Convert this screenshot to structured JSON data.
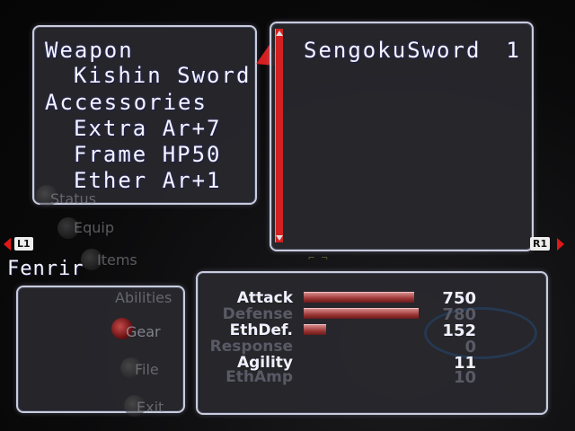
{
  "equipment": {
    "weapon_label": "Weapon",
    "weapon_value": "Kishin Sword",
    "accessories_label": "Accessories",
    "accessories": [
      "Extra Ar+7",
      "Frame HP50",
      "Ether Ar+1"
    ]
  },
  "item_list": {
    "items": [
      {
        "name": "SengokuSword",
        "qty": "1"
      }
    ]
  },
  "shoulder": {
    "left": "L1",
    "right": "R1"
  },
  "character": {
    "name": "Fenrir"
  },
  "menu": {
    "items": [
      "Status",
      "Equip",
      "Items",
      "Abilities",
      "Gear",
      "File",
      "Exit"
    ],
    "active": "Gear"
  },
  "stats": [
    {
      "label": "Attack",
      "value": "750",
      "bar": 0.79,
      "dim": false
    },
    {
      "label": "Defense",
      "value": "780",
      "bar": 0.82,
      "dim": true
    },
    {
      "label": "EthDef.",
      "value": "152",
      "bar": 0.16,
      "dim": false
    },
    {
      "label": "Response",
      "value": "0",
      "bar": 0,
      "dim": true
    },
    {
      "label": "Agility",
      "value": "11",
      "bar": 0,
      "dim": false
    },
    {
      "label": "EthAmp",
      "value": "10",
      "bar": 0,
      "dim": true
    }
  ],
  "colors": {
    "accent": "#d42020",
    "panel_border": "#c9ccdc",
    "text": "#f4f4ff"
  }
}
